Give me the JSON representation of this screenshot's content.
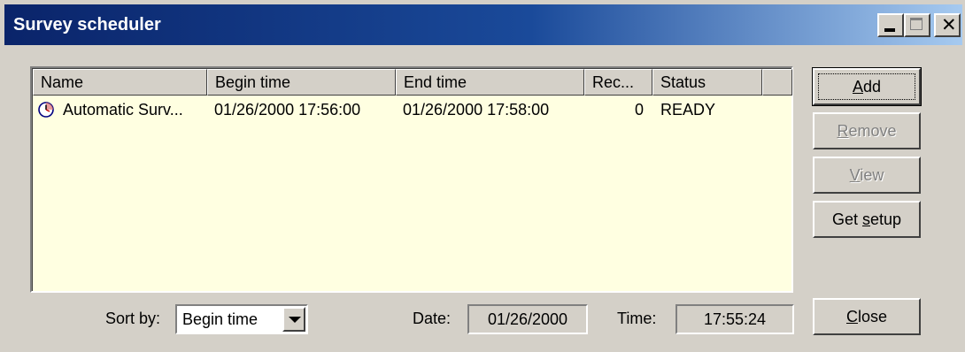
{
  "window": {
    "title": "Survey scheduler"
  },
  "list": {
    "columns": [
      "Name",
      "Begin time",
      "End time",
      "Rec...",
      "Status",
      ""
    ],
    "rows": [
      {
        "icon": "clock-icon",
        "name": "Automatic Surv...",
        "begin_time": "01/26/2000 17:56:00",
        "end_time": "01/26/2000 17:58:00",
        "rec": "0",
        "status": "READY"
      }
    ]
  },
  "buttons": {
    "add": {
      "pre": "",
      "accel": "A",
      "post": "dd"
    },
    "remove": {
      "pre": "",
      "accel": "R",
      "post": "emove"
    },
    "view": {
      "pre": "",
      "accel": "V",
      "post": "iew"
    },
    "get_setup": {
      "pre": "Get ",
      "accel": "s",
      "post": "etup"
    },
    "close": {
      "pre": "",
      "accel": "C",
      "post": "lose"
    }
  },
  "footer": {
    "sort_label": "Sort by:",
    "sort_value": "Begin time",
    "date_label": "Date:",
    "date_value": "01/26/2000",
    "time_label": "Time:",
    "time_value": "17:55:24"
  },
  "colors": {
    "list_background": "#ffffe1",
    "title_gradient_start": "#0a246a",
    "title_gradient_end": "#a6caf0",
    "face": "#d4d0c8"
  }
}
